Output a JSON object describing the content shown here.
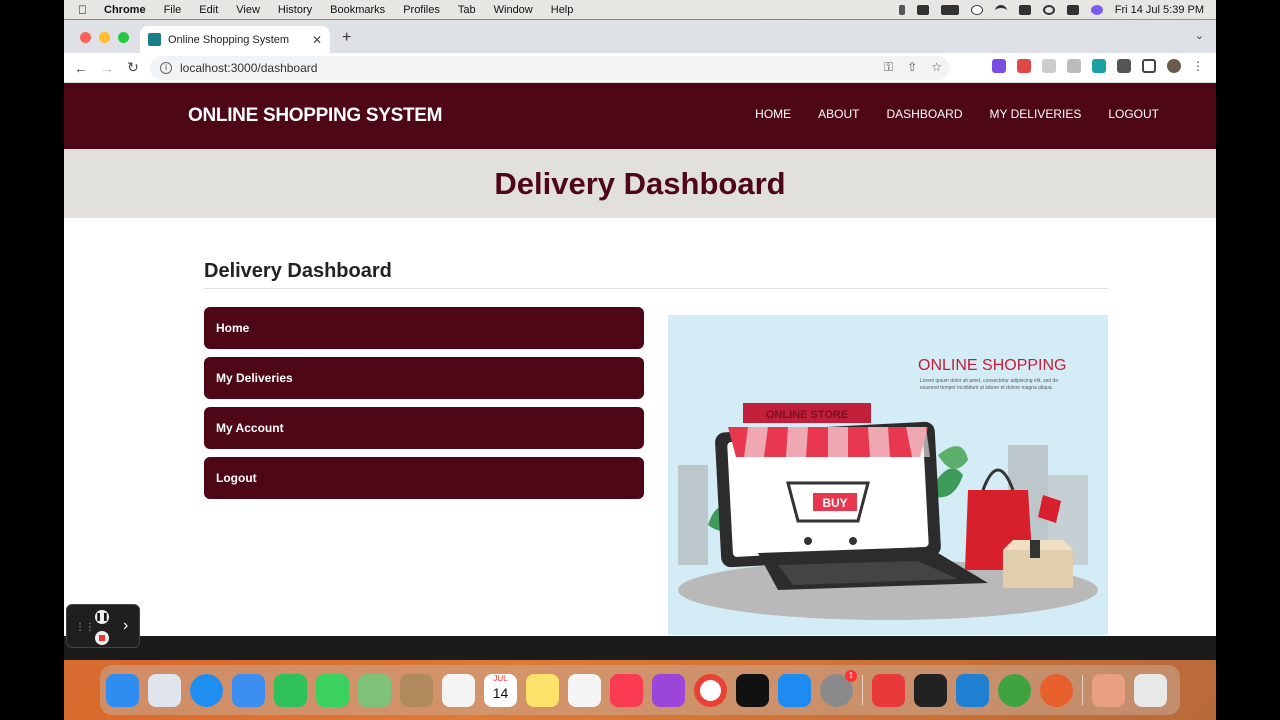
{
  "menubar": {
    "app": "Chrome",
    "items": [
      "File",
      "Edit",
      "View",
      "History",
      "Bookmarks",
      "Profiles",
      "Tab",
      "Window",
      "Help"
    ],
    "clock": "Fri 14 Jul  5:39 PM"
  },
  "browser": {
    "tab_title": "Online Shopping System",
    "url": "localhost:3000/dashboard"
  },
  "site": {
    "brand": "ONLINE SHOPPING SYSTEM",
    "nav": [
      "HOME",
      "ABOUT",
      "DASHBOARD",
      "MY DELIVERIES",
      "LOGOUT"
    ],
    "hero_title": "Delivery Dashboard",
    "section_title": "Delivery Dashboard",
    "menu": [
      "Home",
      "My Deliveries",
      "My Account",
      "Logout"
    ],
    "illustration": {
      "title": "ONLINE SHOPPING",
      "lorem": "Lorem ipsum dolor sit amet, consectetur adipiscing elit, sed do eiusmod tempor incididunt ut labore et dolore magna aliqua.",
      "store_sign": "ONLINE STORE",
      "buy": "BUY"
    },
    "colors": {
      "primary": "#4d0716",
      "hero_bg": "#e2e0dc",
      "accent": "#c21f3a"
    }
  },
  "dock": {
    "calendar_month": "JUL",
    "calendar_day": "14",
    "settings_badge": "1"
  }
}
